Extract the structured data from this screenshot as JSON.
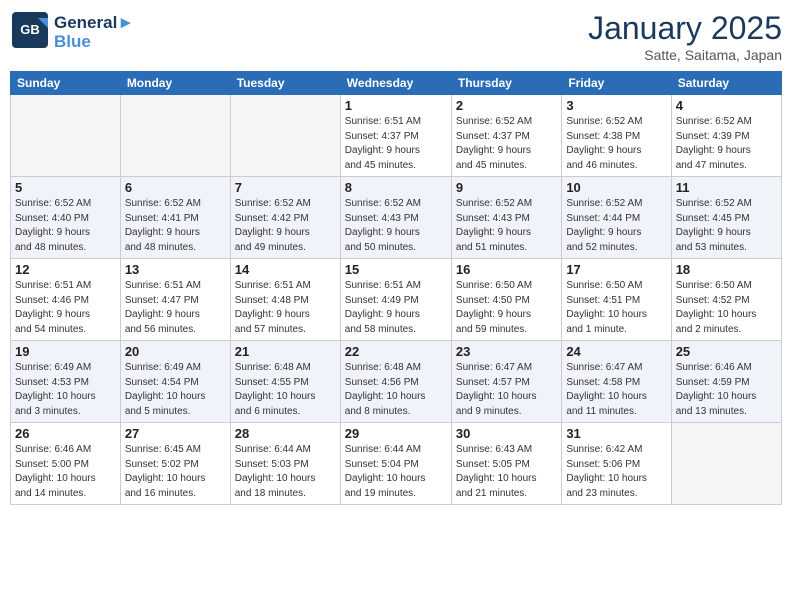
{
  "header": {
    "logo_line1": "General",
    "logo_line2": "Blue",
    "month": "January 2025",
    "location": "Satte, Saitama, Japan"
  },
  "weekdays": [
    "Sunday",
    "Monday",
    "Tuesday",
    "Wednesday",
    "Thursday",
    "Friday",
    "Saturday"
  ],
  "weeks": [
    [
      {
        "day": "",
        "info": ""
      },
      {
        "day": "",
        "info": ""
      },
      {
        "day": "",
        "info": ""
      },
      {
        "day": "1",
        "info": "Sunrise: 6:51 AM\nSunset: 4:37 PM\nDaylight: 9 hours\nand 45 minutes."
      },
      {
        "day": "2",
        "info": "Sunrise: 6:52 AM\nSunset: 4:37 PM\nDaylight: 9 hours\nand 45 minutes."
      },
      {
        "day": "3",
        "info": "Sunrise: 6:52 AM\nSunset: 4:38 PM\nDaylight: 9 hours\nand 46 minutes."
      },
      {
        "day": "4",
        "info": "Sunrise: 6:52 AM\nSunset: 4:39 PM\nDaylight: 9 hours\nand 47 minutes."
      }
    ],
    [
      {
        "day": "5",
        "info": "Sunrise: 6:52 AM\nSunset: 4:40 PM\nDaylight: 9 hours\nand 48 minutes."
      },
      {
        "day": "6",
        "info": "Sunrise: 6:52 AM\nSunset: 4:41 PM\nDaylight: 9 hours\nand 48 minutes."
      },
      {
        "day": "7",
        "info": "Sunrise: 6:52 AM\nSunset: 4:42 PM\nDaylight: 9 hours\nand 49 minutes."
      },
      {
        "day": "8",
        "info": "Sunrise: 6:52 AM\nSunset: 4:43 PM\nDaylight: 9 hours\nand 50 minutes."
      },
      {
        "day": "9",
        "info": "Sunrise: 6:52 AM\nSunset: 4:43 PM\nDaylight: 9 hours\nand 51 minutes."
      },
      {
        "day": "10",
        "info": "Sunrise: 6:52 AM\nSunset: 4:44 PM\nDaylight: 9 hours\nand 52 minutes."
      },
      {
        "day": "11",
        "info": "Sunrise: 6:52 AM\nSunset: 4:45 PM\nDaylight: 9 hours\nand 53 minutes."
      }
    ],
    [
      {
        "day": "12",
        "info": "Sunrise: 6:51 AM\nSunset: 4:46 PM\nDaylight: 9 hours\nand 54 minutes."
      },
      {
        "day": "13",
        "info": "Sunrise: 6:51 AM\nSunset: 4:47 PM\nDaylight: 9 hours\nand 56 minutes."
      },
      {
        "day": "14",
        "info": "Sunrise: 6:51 AM\nSunset: 4:48 PM\nDaylight: 9 hours\nand 57 minutes."
      },
      {
        "day": "15",
        "info": "Sunrise: 6:51 AM\nSunset: 4:49 PM\nDaylight: 9 hours\nand 58 minutes."
      },
      {
        "day": "16",
        "info": "Sunrise: 6:50 AM\nSunset: 4:50 PM\nDaylight: 9 hours\nand 59 minutes."
      },
      {
        "day": "17",
        "info": "Sunrise: 6:50 AM\nSunset: 4:51 PM\nDaylight: 10 hours\nand 1 minute."
      },
      {
        "day": "18",
        "info": "Sunrise: 6:50 AM\nSunset: 4:52 PM\nDaylight: 10 hours\nand 2 minutes."
      }
    ],
    [
      {
        "day": "19",
        "info": "Sunrise: 6:49 AM\nSunset: 4:53 PM\nDaylight: 10 hours\nand 3 minutes."
      },
      {
        "day": "20",
        "info": "Sunrise: 6:49 AM\nSunset: 4:54 PM\nDaylight: 10 hours\nand 5 minutes."
      },
      {
        "day": "21",
        "info": "Sunrise: 6:48 AM\nSunset: 4:55 PM\nDaylight: 10 hours\nand 6 minutes."
      },
      {
        "day": "22",
        "info": "Sunrise: 6:48 AM\nSunset: 4:56 PM\nDaylight: 10 hours\nand 8 minutes."
      },
      {
        "day": "23",
        "info": "Sunrise: 6:47 AM\nSunset: 4:57 PM\nDaylight: 10 hours\nand 9 minutes."
      },
      {
        "day": "24",
        "info": "Sunrise: 6:47 AM\nSunset: 4:58 PM\nDaylight: 10 hours\nand 11 minutes."
      },
      {
        "day": "25",
        "info": "Sunrise: 6:46 AM\nSunset: 4:59 PM\nDaylight: 10 hours\nand 13 minutes."
      }
    ],
    [
      {
        "day": "26",
        "info": "Sunrise: 6:46 AM\nSunset: 5:00 PM\nDaylight: 10 hours\nand 14 minutes."
      },
      {
        "day": "27",
        "info": "Sunrise: 6:45 AM\nSunset: 5:02 PM\nDaylight: 10 hours\nand 16 minutes."
      },
      {
        "day": "28",
        "info": "Sunrise: 6:44 AM\nSunset: 5:03 PM\nDaylight: 10 hours\nand 18 minutes."
      },
      {
        "day": "29",
        "info": "Sunrise: 6:44 AM\nSunset: 5:04 PM\nDaylight: 10 hours\nand 19 minutes."
      },
      {
        "day": "30",
        "info": "Sunrise: 6:43 AM\nSunset: 5:05 PM\nDaylight: 10 hours\nand 21 minutes."
      },
      {
        "day": "31",
        "info": "Sunrise: 6:42 AM\nSunset: 5:06 PM\nDaylight: 10 hours\nand 23 minutes."
      },
      {
        "day": "",
        "info": ""
      }
    ]
  ]
}
